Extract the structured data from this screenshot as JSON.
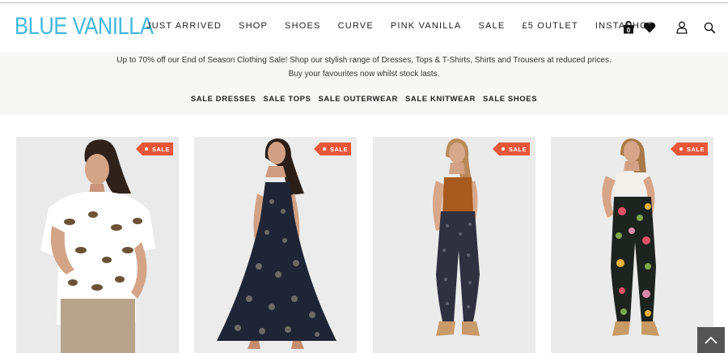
{
  "header": {
    "logo": "BLUE VANILLA",
    "nav": [
      {
        "label": "JUST ARRIVED"
      },
      {
        "label": "SHOP"
      },
      {
        "label": "SHOES"
      },
      {
        "label": "CURVE"
      },
      {
        "label": "PINK VANILLA"
      },
      {
        "label": "SALE"
      },
      {
        "label": "£5 OUTLET"
      },
      {
        "label": "INSTASHOP"
      }
    ],
    "cart_count": "0",
    "icons": [
      "bag-icon",
      "heart-icon",
      "user-icon",
      "search-icon"
    ]
  },
  "promo": {
    "line1": "Up to 70% off our End of Season Clothing Sale! Shop our stylish range of Dresses, Tops & T-Shirts, Shirts and Trousers at reduced prices.",
    "line2": "Buy your favourites now whilst stock lasts.",
    "links": [
      "SALE DRESSES",
      "SALE TOPS",
      "SALE OUTERWEAR",
      "SALE KNITWEAR",
      "SALE SHOES"
    ]
  },
  "products": [
    {
      "badge": "SALE"
    },
    {
      "badge": "SALE"
    },
    {
      "badge": "SALE"
    },
    {
      "badge": "SALE"
    }
  ],
  "colors": {
    "brand": "#3fb8de",
    "sale_badge": "#e8563a",
    "promo_bg": "#f7f7f6"
  }
}
